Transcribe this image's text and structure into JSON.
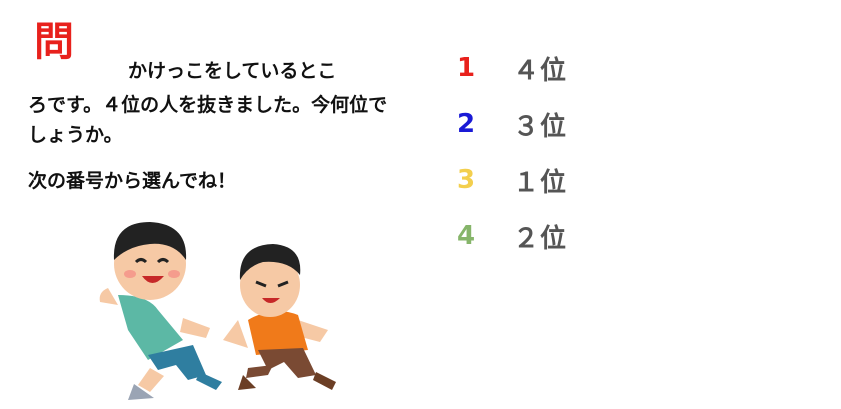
{
  "question": {
    "mark": "問",
    "line1": "かけっこをしているとこ",
    "rest": "ろです。４位の人を抜きました。今何位でしょうか。",
    "instruction": "次の番号から選んでね！"
  },
  "choices": [
    {
      "number": "1",
      "text": "４位",
      "color": "#e8211c"
    },
    {
      "number": "2",
      "text": "３位",
      "color": "#1a1ad6"
    },
    {
      "number": "3",
      "text": "１位",
      "color": "#f3cf4e"
    },
    {
      "number": "4",
      "text": "２位",
      "color": "#86b56a"
    }
  ],
  "illustration": {
    "icon": "running-kids-illustration"
  }
}
